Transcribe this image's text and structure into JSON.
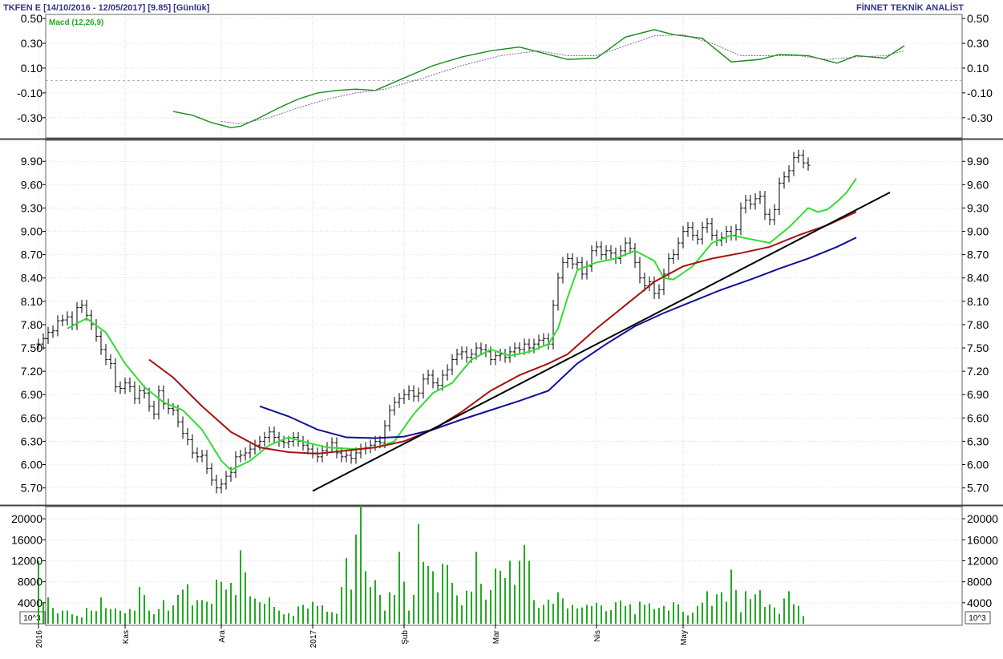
{
  "header": {
    "title": "TKFEN E  [14/10/2016 - 12/05/2017]  [9.85]  [Günlük]",
    "brand": "FİNNET TEKNİK ANALİST"
  },
  "colors": {
    "macd_line": "#1a8a1a",
    "macd_signal": "#7a6a9a",
    "ma_short": "#33dd33",
    "ma_mid": "#aa1111",
    "ma_long": "#111199",
    "trendline": "#000000",
    "volume": "#22aa22",
    "grid": "#aaaaaa",
    "bars": "#000000"
  },
  "chart_data": [
    {
      "type": "line",
      "panel": "macd",
      "legend": "Macd (12,26,9)",
      "ylim": [
        -0.45,
        0.52
      ],
      "y_ticks": [
        0.5,
        0.3,
        0.1,
        -0.1,
        -0.3
      ],
      "y_tick_labels": [
        "0.50",
        "0.30",
        "0.10",
        "-0.10",
        "-0.30"
      ],
      "zero_line": 0.0,
      "x_range": [
        0,
        182
      ],
      "series": [
        {
          "role": "macd",
          "x": [
            28,
            32,
            36,
            40,
            42,
            46,
            50,
            54,
            58,
            62,
            66,
            70,
            76,
            82,
            88,
            94,
            100,
            106,
            110,
            116,
            122,
            128,
            132,
            138,
            144,
            150,
            154,
            160,
            166,
            170,
            176,
            180
          ],
          "y": [
            -0.25,
            -0.28,
            -0.34,
            -0.38,
            -0.37,
            -0.3,
            -0.22,
            -0.15,
            -0.1,
            -0.08,
            -0.07,
            -0.08,
            0.02,
            0.12,
            0.19,
            0.24,
            0.27,
            0.21,
            0.17,
            0.18,
            0.35,
            0.41,
            0.37,
            0.34,
            0.15,
            0.17,
            0.21,
            0.2,
            0.14,
            0.2,
            0.18,
            0.28
          ]
        },
        {
          "role": "signal",
          "x": [
            38,
            42,
            48,
            54,
            60,
            66,
            72,
            80,
            88,
            96,
            104,
            110,
            116,
            122,
            128,
            134,
            140,
            146,
            152,
            158,
            164,
            170,
            176,
            180
          ],
          "y": [
            -0.33,
            -0.35,
            -0.3,
            -0.22,
            -0.15,
            -0.1,
            -0.07,
            0.02,
            0.12,
            0.2,
            0.24,
            0.2,
            0.2,
            0.28,
            0.36,
            0.37,
            0.3,
            0.2,
            0.2,
            0.2,
            0.17,
            0.19,
            0.2,
            0.24
          ]
        }
      ]
    },
    {
      "type": "line",
      "panel": "price",
      "ylim": [
        5.5,
        10.15
      ],
      "y_ticks": [
        9.9,
        9.6,
        9.3,
        9.0,
        8.7,
        8.4,
        8.1,
        7.8,
        7.5,
        7.2,
        6.9,
        6.6,
        6.3,
        6.0,
        5.7
      ],
      "y_tick_labels": [
        "9.90",
        "9.60",
        "9.30",
        "9.00",
        "8.70",
        "8.40",
        "8.10",
        "7.80",
        "7.50",
        "7.20",
        "6.90",
        "6.60",
        "6.30",
        "6.00",
        "5.70"
      ],
      "x_range": [
        0,
        182
      ],
      "ohlc": {
        "close": [
          7.55,
          7.62,
          7.7,
          7.72,
          7.85,
          7.86,
          7.9,
          7.8,
          8.02,
          8.05,
          7.92,
          7.8,
          7.65,
          7.48,
          7.35,
          7.3,
          7.0,
          6.98,
          7.05,
          7.0,
          6.85,
          6.95,
          6.92,
          6.75,
          6.65,
          6.95,
          6.78,
          6.72,
          6.7,
          6.55,
          6.4,
          6.32,
          6.15,
          6.1,
          6.12,
          5.95,
          5.8,
          5.7,
          5.75,
          5.85,
          5.9,
          6.1,
          6.12,
          6.15,
          6.2,
          6.25,
          6.3,
          6.35,
          6.42,
          6.35,
          6.3,
          6.28,
          6.3,
          6.35,
          6.3,
          6.25,
          6.2,
          6.15,
          6.1,
          6.18,
          6.22,
          6.28,
          6.15,
          6.1,
          6.12,
          6.08,
          6.15,
          6.2,
          6.22,
          6.25,
          6.3,
          6.28,
          6.5,
          6.7,
          6.8,
          6.85,
          6.9,
          6.95,
          6.88,
          6.92,
          7.1,
          7.15,
          7.05,
          7.02,
          7.15,
          7.22,
          7.35,
          7.42,
          7.45,
          7.38,
          7.42,
          7.5,
          7.48,
          7.45,
          7.35,
          7.4,
          7.42,
          7.38,
          7.45,
          7.5,
          7.48,
          7.55,
          7.5,
          7.55,
          7.6,
          7.62,
          7.55,
          8.05,
          8.4,
          8.6,
          8.65,
          8.58,
          8.6,
          8.45,
          8.55,
          8.75,
          8.8,
          8.7,
          8.75,
          8.72,
          8.65,
          8.75,
          8.85,
          8.78,
          8.6,
          8.4,
          8.3,
          8.35,
          8.2,
          8.25,
          8.45,
          8.65,
          8.7,
          8.85,
          9.0,
          9.05,
          8.95,
          8.9,
          9.05,
          9.1,
          8.95,
          8.88,
          8.92,
          9.0,
          8.95,
          9.02,
          9.3,
          9.4,
          9.35,
          9.42,
          9.45,
          9.22,
          9.15,
          9.28,
          9.62,
          9.7,
          9.78,
          9.95,
          9.98,
          9.88,
          9.85
        ],
        "x_start": 0,
        "x_step": 1.0
      },
      "series": [
        {
          "role": "ma_short",
          "x": [
            6,
            10,
            14,
            18,
            22,
            26,
            30,
            34,
            38,
            40,
            44,
            48,
            52,
            56,
            60,
            66,
            70,
            74,
            78,
            82,
            86,
            90,
            94,
            98,
            102,
            104,
            106,
            108,
            110,
            112,
            116,
            120,
            124,
            128,
            130,
            132,
            136,
            140,
            144,
            148,
            152,
            156,
            160,
            162,
            164,
            166,
            168,
            170
          ],
          "y": [
            7.75,
            7.88,
            7.7,
            7.3,
            7.0,
            6.8,
            6.7,
            6.45,
            6.05,
            5.93,
            6.05,
            6.25,
            6.35,
            6.28,
            6.22,
            6.2,
            6.22,
            6.3,
            6.65,
            6.92,
            7.05,
            7.35,
            7.48,
            7.4,
            7.45,
            7.5,
            7.55,
            7.75,
            8.15,
            8.5,
            8.6,
            8.65,
            8.75,
            8.62,
            8.4,
            8.38,
            8.55,
            8.85,
            8.95,
            8.9,
            8.85,
            9.05,
            9.3,
            9.25,
            9.28,
            9.38,
            9.5,
            9.68
          ]
        },
        {
          "role": "ma_mid",
          "x": [
            23,
            28,
            34,
            40,
            46,
            52,
            58,
            64,
            70,
            76,
            82,
            88,
            94,
            100,
            106,
            110,
            116,
            122,
            128,
            134,
            140,
            146,
            152,
            158,
            164,
            170
          ],
          "y": [
            7.35,
            7.12,
            6.75,
            6.42,
            6.22,
            6.16,
            6.14,
            6.18,
            6.22,
            6.3,
            6.45,
            6.68,
            6.95,
            7.15,
            7.3,
            7.42,
            7.75,
            8.05,
            8.35,
            8.55,
            8.65,
            8.72,
            8.8,
            8.95,
            9.08,
            9.25
          ]
        },
        {
          "role": "ma_long",
          "x": [
            46,
            52,
            58,
            64,
            70,
            76,
            82,
            88,
            94,
            100,
            106,
            112,
            118,
            124,
            130,
            136,
            142,
            148,
            154,
            160,
            166,
            170
          ],
          "y": [
            6.75,
            6.62,
            6.45,
            6.35,
            6.34,
            6.36,
            6.45,
            6.58,
            6.7,
            6.82,
            6.95,
            7.3,
            7.55,
            7.78,
            7.95,
            8.1,
            8.25,
            8.38,
            8.52,
            8.65,
            8.8,
            8.92
          ]
        },
        {
          "role": "trendline",
          "x": [
            57,
            177
          ],
          "y": [
            5.66,
            9.5
          ]
        }
      ]
    },
    {
      "type": "bar",
      "panel": "volume",
      "multiplier_label": "10^3",
      "ylim": [
        0,
        22000
      ],
      "y_ticks": [
        20000,
        16000,
        12000,
        8000,
        4000
      ],
      "y_tick_labels": [
        "20000",
        "16000",
        "12000",
        "8000",
        "4000"
      ],
      "x_start": 0,
      "x_step": 1.0,
      "values": [
        12000,
        4000,
        5000,
        3000,
        2000,
        2500,
        2500,
        1800,
        1500,
        1200,
        3000,
        2500,
        2400,
        5000,
        3000,
        2800,
        2900,
        2500,
        2000,
        2800,
        2500,
        7000,
        5500,
        2500,
        1800,
        2800,
        4500,
        2500,
        3500,
        5500,
        6500,
        7500,
        3500,
        4500,
        4500,
        4200,
        3800,
        8400,
        8000,
        6500,
        7800,
        5500,
        14000,
        9800,
        5200,
        4800,
        4100,
        3800,
        5000,
        3200,
        2500,
        1800,
        2000,
        1500,
        3300,
        3600,
        2900,
        4200,
        3400,
        3500,
        2300,
        2200,
        1900,
        7000,
        12500,
        6500,
        17000,
        22500,
        10000,
        7000,
        8300,
        5500,
        2500,
        6000,
        5500,
        13700,
        8000,
        2500,
        5500,
        19000,
        11800,
        11000,
        10000,
        6000,
        11400,
        11200,
        7800,
        5400,
        3500,
        6300,
        6100,
        13700,
        7600,
        4600,
        6400,
        10500,
        10100,
        8700,
        12000,
        7400,
        12000,
        15000,
        12000,
        4500,
        3000,
        3600,
        4600,
        3800,
        6000,
        4800,
        2900,
        3600,
        2900,
        3100,
        3600,
        3400,
        4000,
        3500,
        2400,
        2600,
        4100,
        4400,
        3400,
        3700,
        1800,
        4200,
        3600,
        3900,
        2800,
        3000,
        3400,
        2500,
        4100,
        3700,
        2300,
        1600,
        2100,
        3400,
        4000,
        6200,
        3400,
        5600,
        6000,
        4200,
        10300,
        6400,
        2200,
        6200,
        4700,
        5600,
        6400,
        3200,
        3700,
        3100,
        1900,
        4800,
        6200,
        3700,
        3400,
        1500
      ]
    }
  ],
  "x_axis": {
    "labels": [
      {
        "x": 0,
        "text": "2016"
      },
      {
        "x": 18,
        "text": "Kas"
      },
      {
        "x": 38,
        "text": "Ara"
      },
      {
        "x": 57,
        "text": "2017"
      },
      {
        "x": 76,
        "text": "Şub"
      },
      {
        "x": 95,
        "text": "Mar"
      },
      {
        "x": 116,
        "text": "Nis"
      },
      {
        "x": 134,
        "text": "May"
      }
    ]
  }
}
